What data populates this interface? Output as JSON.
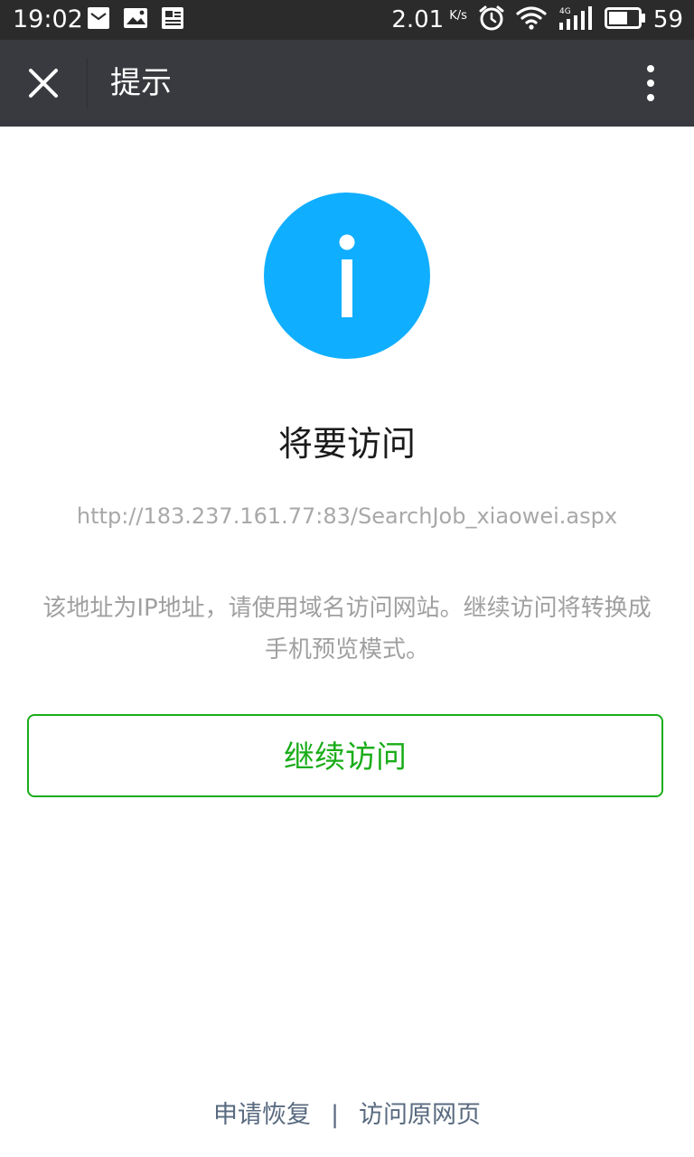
{
  "status_bar": {
    "time": "19:02",
    "speed": "2.01",
    "speed_unit": "K/s",
    "battery_level": "59",
    "icons": [
      "mail-icon",
      "photo-icon",
      "news-icon",
      "alarm-icon",
      "wifi-icon",
      "signal-4g-icon",
      "battery-icon"
    ]
  },
  "app_bar": {
    "title": "提示",
    "close_icon": "close-icon",
    "more_icon": "more-vertical-icon"
  },
  "content": {
    "icon": "info-icon",
    "headline": "将要访问",
    "url": "http://183.237.161.77:83/SearchJob_xiaowei.aspx",
    "message": "该地址为IP地址，请使用域名访问网站。继续访问将转换成手机预览模式。",
    "continue_label": "继续访问"
  },
  "footer": {
    "restore_label": "申请恢复",
    "separator": "|",
    "original_label": "访问原网页"
  },
  "colors": {
    "status_bar_bg": "#2b2b2b",
    "app_bar_bg": "#393a3f",
    "info_blue": "#10aeff",
    "accent_green": "#1aad19",
    "link_color": "#596a80"
  }
}
